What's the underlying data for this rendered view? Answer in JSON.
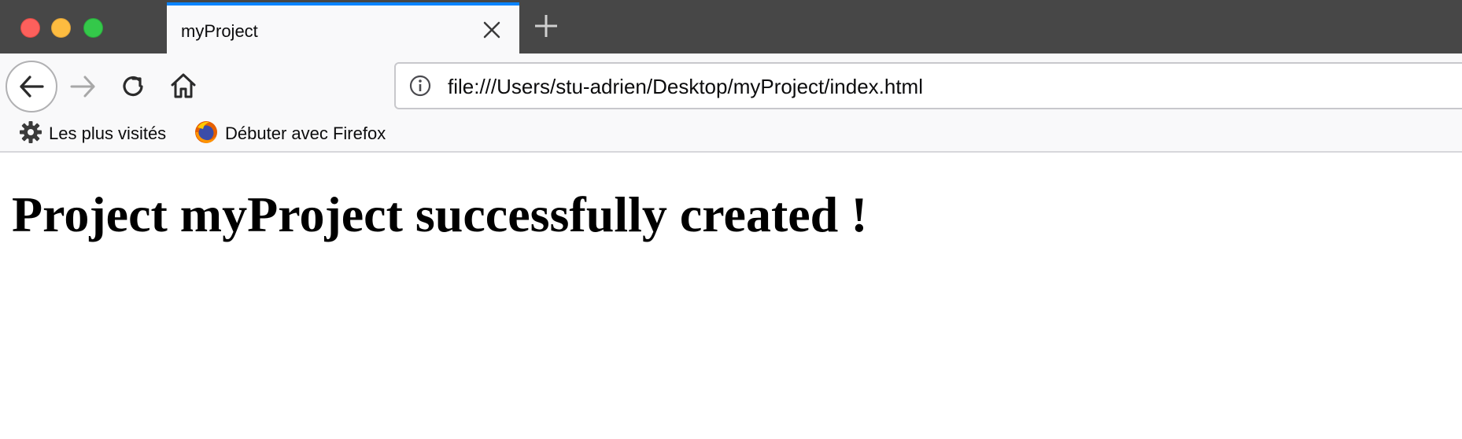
{
  "window": {
    "traffic_lights": {
      "close": "#fc605c",
      "minimize": "#fdbc40",
      "maximize": "#34c84a"
    }
  },
  "tab": {
    "title": "myProject",
    "accent_color": "#0a84ff",
    "close_icon": "close-icon",
    "new_tab_icon": "plus-icon"
  },
  "nav": {
    "back_icon": "arrow-left-icon",
    "forward_icon": "arrow-right-icon",
    "reload_icon": "reload-icon",
    "home_icon": "home-icon",
    "info_icon": "info-icon",
    "url": "file:///Users/stu-adrien/Desktop/myProject/index.html"
  },
  "bookmarks": {
    "items": [
      {
        "label": "Les plus visités",
        "icon": "gear-icon"
      },
      {
        "label": "Débuter avec Firefox",
        "icon": "firefox-icon"
      }
    ]
  },
  "page": {
    "heading": "Project myProject successfully created !"
  }
}
